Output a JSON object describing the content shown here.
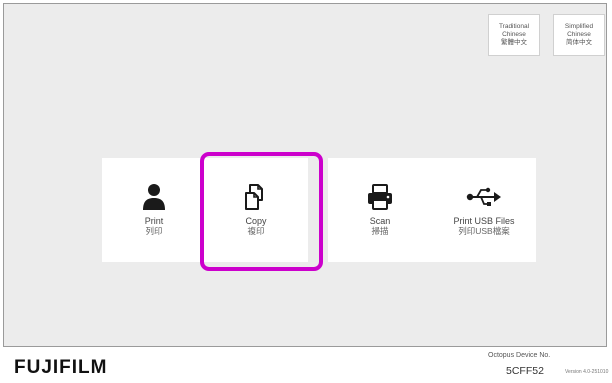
{
  "language_buttons": [
    {
      "line1": "Traditional",
      "line2": "Chinese",
      "line3": "繁體中文"
    },
    {
      "line1": "Simplified",
      "line2": "Chinese",
      "line3": "简体中文"
    }
  ],
  "tiles": [
    {
      "icon": "person-icon",
      "label": "Print",
      "sublabel": "列印"
    },
    {
      "icon": "copy-icon",
      "label": "Copy",
      "sublabel": "複印"
    },
    {
      "icon": "printer-icon",
      "label": "Scan",
      "sublabel": "掃描"
    },
    {
      "icon": "usb-icon",
      "label": "Print USB Files",
      "sublabel": "列印USB檔案"
    }
  ],
  "highlighted_tile": "Copy",
  "colors": {
    "background": "#ececec",
    "tile": "#ffffff",
    "highlight": "#cc00cc",
    "icon": "#1a1a1a"
  },
  "footer": {
    "logo": "FUJIFILM",
    "device_label": "Octopus Device No.",
    "device_id": "5CFF52",
    "version": "Version 4.0-251010"
  }
}
